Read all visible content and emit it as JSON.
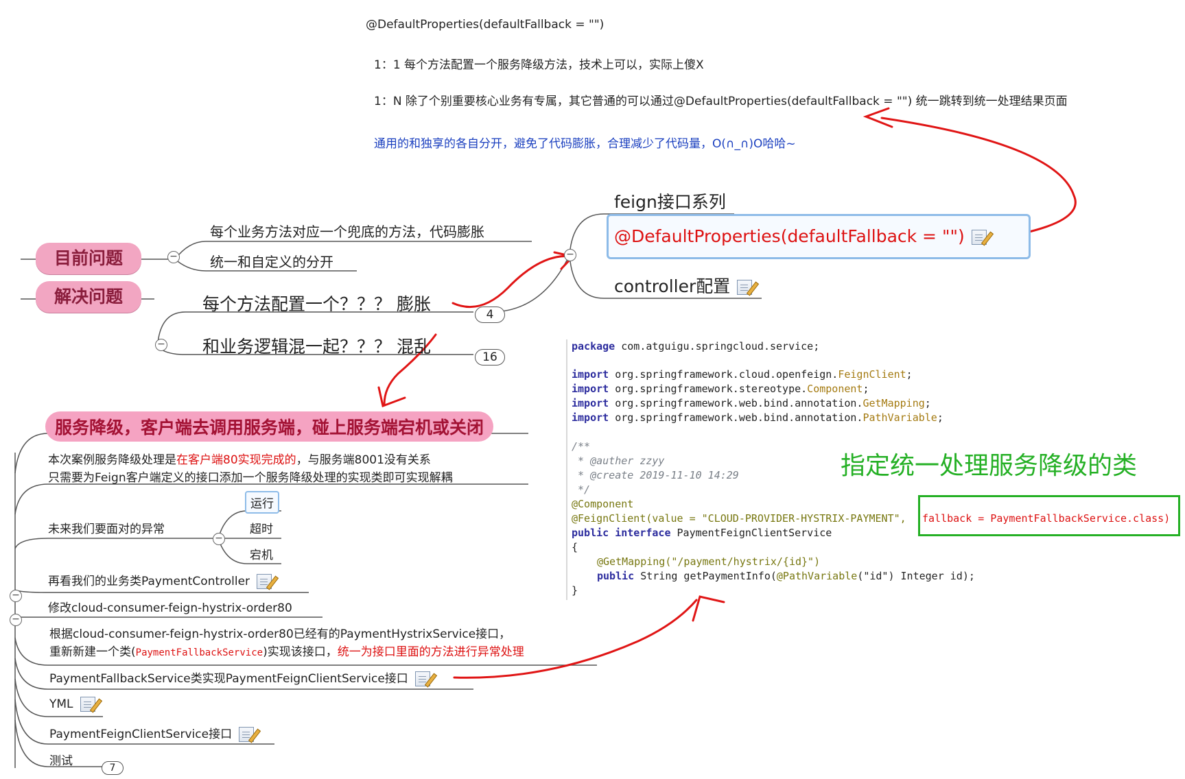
{
  "top_notes": {
    "line1": "@DefaultProperties(defaultFallback = \"\")",
    "line2": "1：1 每个方法配置一个服务降级方法，技术上可以，实际上傻X",
    "line3": "1：N 除了个别重要核心业务有专属，其它普通的可以通过@DefaultProperties(defaultFallback = \"\")  统一跳转到统一处理结果页面",
    "line4": "通用的和独享的各自分开，避免了代码膨胀，合理减少了代码量，O(∩_∩)O哈哈~"
  },
  "upper_map": {
    "node_problem": "目前问题",
    "node_solution": "解决问题",
    "problem_items": [
      "每个业务方法对应一个兜底的方法，代码膨胀",
      "统一和自定义的分开"
    ],
    "solution_items": [
      "每个方法配置一个？？？ 膨胀",
      "和业务逻辑混一起？？？ 混乱"
    ],
    "badge_1": "4",
    "badge_2": "16",
    "feign_items": [
      "feign接口系列",
      "@DefaultProperties(defaultFallback = \"\")",
      "controller配置"
    ]
  },
  "lower_map": {
    "banner": "服务降级，客户端去调用服务端，碰上服务端宕机或关闭",
    "intro_1_a": "本次案例服务降级处理是",
    "intro_1_b": "在客户端80实现完成的",
    "intro_1_c": "，与服务端8001没有关系",
    "intro_2": "只需要为Feign客户端定义的接口添加一个服务降级处理的实现类即可实现解耦",
    "exceptions_label": "未来我们要面对的异常",
    "exceptions": [
      "运行",
      "超时",
      "宕机"
    ],
    "item_controller": "再看我们的业务类PaymentController",
    "item_modify": "修改cloud-consumer-feign-hystrix-order80",
    "item_new_1": "根据cloud-consumer-feign-hystrix-order80已经有的PaymentHystrixService接口，",
    "item_new_2_a": "重新新建一个类(",
    "item_new_2_b": "PaymentFallbackService",
    "item_new_2_c": ")实现该接口，",
    "item_new_2_d": "统一为接口里面的方法进行异常处理",
    "item_impl": "PaymentFallbackService类实现PaymentFeignClientService接口",
    "item_yml": "YML",
    "item_iface": "PaymentFeignClientService接口",
    "item_test": "测试",
    "badge_test": "7"
  },
  "code": {
    "pkg_kw": "package",
    "pkg": " com.atguigu.springcloud.service;",
    "imports": [
      {
        "kw": "import",
        "pre": " org.springframework.cloud.openfeign.",
        "cls": "FeignClient",
        "post": ";"
      },
      {
        "kw": "import",
        "pre": " org.springframework.stereotype.",
        "cls": "Component",
        "post": ";"
      },
      {
        "kw": "import",
        "pre": " org.springframework.web.bind.annotation.",
        "cls": "GetMapping",
        "post": ";"
      },
      {
        "kw": "import",
        "pre": " org.springframework.web.bind.annotation.",
        "cls": "PathVariable",
        "post": ";"
      }
    ],
    "c1": "/**",
    "c2": " * @auther zzyy",
    "c3": " * @create 2019-11-10 14:29",
    "c4": " */",
    "ann_component": "@Component",
    "feign_ann": "@FeignClient(value = \"CLOUD-PROVIDER-HYSTRIX-PAYMENT\",",
    "fallback": "fallback = PaymentFallbackService.class)",
    "iface_kw": "public interface",
    "iface_name": " PaymentFeignClientService",
    "brace_open": "{",
    "getmapping": "@GetMapping(\"/payment/hystrix/{id}\")",
    "method_kw": "public",
    "method_a": " String getPaymentInfo(",
    "method_ann": "@PathVariable",
    "method_b": "(\"id\") Integer id);",
    "brace_close": "}"
  },
  "green_label": "指定统一处理服务降级的类",
  "colors": {
    "pink": "#f2a6c2",
    "red_arrow": "#e01515",
    "green": "#25b025",
    "blue_text": "#1a3fbf",
    "select_border": "#8dbbe8"
  }
}
